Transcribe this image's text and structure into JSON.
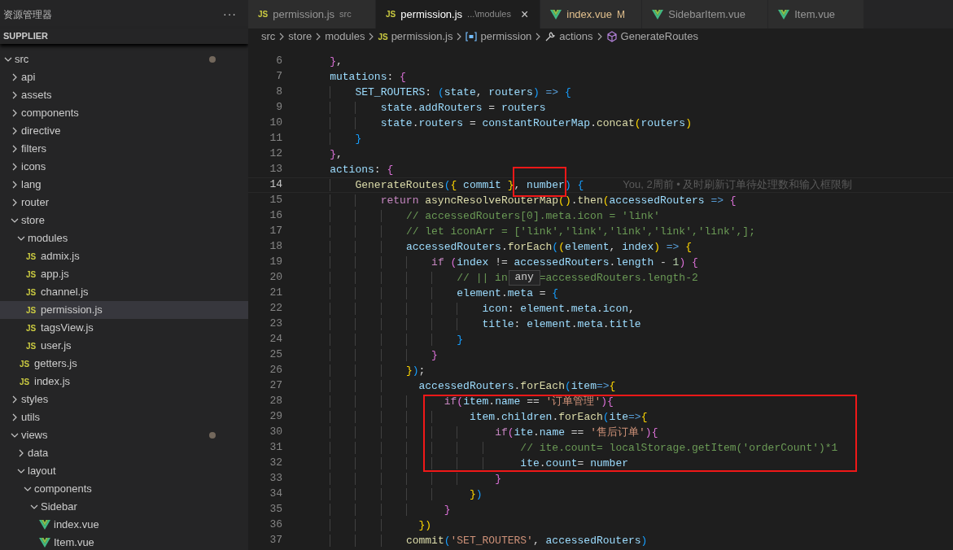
{
  "sidebar": {
    "title": "资源管理器",
    "more": "···",
    "section": "SUPPLIER",
    "tree": [
      {
        "label": "src",
        "kind": "folder",
        "expanded": true,
        "selected": false,
        "modified": true,
        "children": [
          {
            "label": "api",
            "kind": "folder",
            "expanded": false,
            "selected": false,
            "modified": false
          },
          {
            "label": "assets",
            "kind": "folder",
            "expanded": false,
            "selected": false,
            "modified": false
          },
          {
            "label": "components",
            "kind": "folder",
            "expanded": false,
            "selected": false,
            "modified": false
          },
          {
            "label": "directive",
            "kind": "folder",
            "expanded": false,
            "selected": false,
            "modified": false
          },
          {
            "label": "filters",
            "kind": "folder",
            "expanded": false,
            "selected": false,
            "modified": false
          },
          {
            "label": "icons",
            "kind": "folder",
            "expanded": false,
            "selected": false,
            "modified": false
          },
          {
            "label": "lang",
            "kind": "folder",
            "expanded": false,
            "selected": false,
            "modified": false
          },
          {
            "label": "router",
            "kind": "folder",
            "expanded": false,
            "selected": false,
            "modified": false
          },
          {
            "label": "store",
            "kind": "folder",
            "expanded": true,
            "selected": false,
            "modified": false,
            "children": [
              {
                "label": "modules",
                "kind": "folder",
                "expanded": true,
                "selected": false,
                "modified": false,
                "children": [
                  {
                    "label": "admix.js",
                    "kind": "js",
                    "badge": "JS",
                    "selected": false,
                    "modified": false
                  },
                  {
                    "label": "app.js",
                    "kind": "js",
                    "badge": "JS",
                    "selected": false,
                    "modified": false
                  },
                  {
                    "label": "channel.js",
                    "kind": "js",
                    "badge": "JS",
                    "selected": false,
                    "modified": false
                  },
                  {
                    "label": "permission.js",
                    "kind": "js",
                    "badge": "JS",
                    "selected": true,
                    "modified": false
                  },
                  {
                    "label": "tagsView.js",
                    "kind": "js",
                    "badge": "JS",
                    "selected": false,
                    "modified": false
                  },
                  {
                    "label": "user.js",
                    "kind": "js",
                    "badge": "JS",
                    "selected": false,
                    "modified": false
                  }
                ]
              },
              {
                "label": "getters.js",
                "kind": "js",
                "badge": "JS",
                "selected": false,
                "modified": false
              },
              {
                "label": "index.js",
                "kind": "js",
                "badge": "JS",
                "selected": false,
                "modified": false
              }
            ]
          },
          {
            "label": "styles",
            "kind": "folder",
            "expanded": false,
            "selected": false,
            "modified": false
          },
          {
            "label": "utils",
            "kind": "folder",
            "expanded": false,
            "selected": false,
            "modified": false
          },
          {
            "label": "views",
            "kind": "folder",
            "expanded": true,
            "selected": false,
            "modified": true,
            "children": [
              {
                "label": "data",
                "kind": "folder",
                "expanded": false,
                "selected": false,
                "modified": false
              },
              {
                "label": "layout",
                "kind": "folder",
                "expanded": true,
                "selected": false,
                "modified": false,
                "children": [
                  {
                    "label": "components",
                    "kind": "folder",
                    "expanded": true,
                    "selected": false,
                    "modified": false,
                    "children": [
                      {
                        "label": "Sidebar",
                        "kind": "folder",
                        "expanded": true,
                        "selected": false,
                        "modified": false,
                        "children": [
                          {
                            "label": "index.vue",
                            "kind": "vue",
                            "selected": false,
                            "modified": false
                          },
                          {
                            "label": "Item.vue",
                            "kind": "vue",
                            "selected": false,
                            "modified": false
                          }
                        ]
                      }
                    ]
                  }
                ]
              }
            ]
          }
        ]
      }
    ]
  },
  "tabs": [
    {
      "label": "permission.js",
      "kind": "js",
      "badge": "JS",
      "description": "src",
      "modified": false,
      "selected": false
    },
    {
      "label": "permission.js",
      "kind": "js",
      "badge": "JS",
      "description": "...\\modules",
      "close": "×",
      "modified": false,
      "selected": true
    },
    {
      "label": "index.vue",
      "kind": "vue",
      "git_status": "M",
      "modified": true,
      "selected": false
    },
    {
      "label": "SidebarItem.vue",
      "kind": "vue",
      "modified": false,
      "selected": false
    },
    {
      "label": "Item.vue",
      "kind": "vue",
      "modified": false,
      "selected": false
    }
  ],
  "breadcrumb": [
    {
      "kind": "folder",
      "label": "src"
    },
    {
      "kind": "folder",
      "label": "store"
    },
    {
      "kind": "folder",
      "label": "modules"
    },
    {
      "kind": "js",
      "badge": "JS",
      "label": "permission.js"
    },
    {
      "kind": "variable",
      "label": "permission"
    },
    {
      "kind": "property",
      "label": "actions"
    },
    {
      "kind": "method",
      "label": "GenerateRoutes"
    }
  ],
  "editor": {
    "lines": [
      {
        "number": "6",
        "current": false,
        "tokens": [
          {
            "kind": "bracket2",
            "text": "    }"
          },
          {
            "kind": "plain",
            "text": ","
          }
        ]
      },
      {
        "number": "7",
        "current": false,
        "tokens": [
          {
            "kind": "name",
            "text": "    mutations"
          },
          {
            "kind": "plain",
            "text": ": "
          },
          {
            "kind": "bracket2",
            "text": "{"
          }
        ]
      },
      {
        "number": "8",
        "current": false,
        "tokens": [
          {
            "kind": "name",
            "text": "        SET_ROUTERS"
          },
          {
            "kind": "plain",
            "text": ": "
          },
          {
            "kind": "bracket3",
            "text": "("
          },
          {
            "kind": "name",
            "text": "state"
          },
          {
            "kind": "plain",
            "text": ", "
          },
          {
            "kind": "name",
            "text": "routers"
          },
          {
            "kind": "bracket3",
            "text": ") "
          },
          {
            "kind": "arrow",
            "text": "=> "
          },
          {
            "kind": "bracket3",
            "text": "{"
          }
        ]
      },
      {
        "number": "9",
        "current": false,
        "tokens": [
          {
            "kind": "name",
            "text": "            state"
          },
          {
            "kind": "plain",
            "text": "."
          },
          {
            "kind": "name",
            "text": "addRouters"
          },
          {
            "kind": "plain",
            "text": " = "
          },
          {
            "kind": "name",
            "text": "routers"
          }
        ]
      },
      {
        "number": "10",
        "current": false,
        "tokens": [
          {
            "kind": "name",
            "text": "            state"
          },
          {
            "kind": "plain",
            "text": "."
          },
          {
            "kind": "name",
            "text": "routers"
          },
          {
            "kind": "plain",
            "text": " = "
          },
          {
            "kind": "name",
            "text": "constantRouterMap"
          },
          {
            "kind": "plain",
            "text": "."
          },
          {
            "kind": "func",
            "text": "concat"
          },
          {
            "kind": "bracket1",
            "text": "("
          },
          {
            "kind": "name",
            "text": "routers"
          },
          {
            "kind": "bracket1",
            "text": ")"
          }
        ]
      },
      {
        "number": "11",
        "current": false,
        "tokens": [
          {
            "kind": "bracket3",
            "text": "        }"
          }
        ]
      },
      {
        "number": "12",
        "current": false,
        "tokens": [
          {
            "kind": "bracket2",
            "text": "    }"
          },
          {
            "kind": "plain",
            "text": ","
          }
        ]
      },
      {
        "number": "13",
        "current": false,
        "tokens": [
          {
            "kind": "name",
            "text": "    actions"
          },
          {
            "kind": "plain",
            "text": ": "
          },
          {
            "kind": "bracket2",
            "text": "{"
          }
        ]
      },
      {
        "number": "14",
        "current": true,
        "blame": "You, 2周前 • 及时刷新订单待处理数和输入框限制",
        "tokens": [
          {
            "kind": "func",
            "text": "        GenerateRoutes"
          },
          {
            "kind": "bracket3",
            "text": "("
          },
          {
            "kind": "bracket1",
            "text": "{ "
          },
          {
            "kind": "name",
            "text": "commit "
          },
          {
            "kind": "bracket1",
            "text": "}"
          },
          {
            "kind": "plain",
            "text": ", "
          },
          {
            "kind": "name",
            "text": "number"
          },
          {
            "kind": "bracket3",
            "text": ") {"
          }
        ]
      },
      {
        "number": "15",
        "current": false,
        "tokens": [
          {
            "kind": "keyword",
            "text": "            return "
          },
          {
            "kind": "func",
            "text": "asyncResolveRouterMap"
          },
          {
            "kind": "bracket1",
            "text": "()"
          },
          {
            "kind": "plain",
            "text": "."
          },
          {
            "kind": "func",
            "text": "then"
          },
          {
            "kind": "bracket1",
            "text": "("
          },
          {
            "kind": "name",
            "text": "accessedRouters "
          },
          {
            "kind": "arrow",
            "text": "=> "
          },
          {
            "kind": "bracket2",
            "text": "{"
          }
        ]
      },
      {
        "number": "16",
        "current": false,
        "tokens": [
          {
            "kind": "comment",
            "text": "                // accessedRouters[0].meta.icon = 'link'"
          }
        ]
      },
      {
        "number": "17",
        "current": false,
        "tokens": [
          {
            "kind": "comment",
            "text": "                // let iconArr = ['link','link','link','link','link',];"
          }
        ]
      },
      {
        "number": "18",
        "current": false,
        "tokens": [
          {
            "kind": "name",
            "text": "                accessedRouters"
          },
          {
            "kind": "plain",
            "text": "."
          },
          {
            "kind": "func",
            "text": "forEach"
          },
          {
            "kind": "bracket3",
            "text": "("
          },
          {
            "kind": "bracket1",
            "text": "("
          },
          {
            "kind": "name",
            "text": "element"
          },
          {
            "kind": "plain",
            "text": ", "
          },
          {
            "kind": "name",
            "text": "index"
          },
          {
            "kind": "bracket1",
            "text": ") "
          },
          {
            "kind": "arrow",
            "text": "=> "
          },
          {
            "kind": "bracket1",
            "text": "{"
          }
        ]
      },
      {
        "number": "19",
        "current": false,
        "tokens": [
          {
            "kind": "keyword",
            "text": "                    if "
          },
          {
            "kind": "bracket2",
            "text": "("
          },
          {
            "kind": "name",
            "text": "index"
          },
          {
            "kind": "plain",
            "text": " != "
          },
          {
            "kind": "name",
            "text": "accessedRouters"
          },
          {
            "kind": "plain",
            "text": "."
          },
          {
            "kind": "name",
            "text": "length"
          },
          {
            "kind": "plain",
            "text": " - "
          },
          {
            "kind": "number",
            "text": "1"
          },
          {
            "kind": "bracket2",
            "text": ") {"
          }
        ]
      },
      {
        "number": "20",
        "current": false,
        "hover_tip": "any",
        "tokens": [
          {
            "kind": "comment",
            "text": "                        // || in     =accessedRouters.length-2"
          }
        ]
      },
      {
        "number": "21",
        "current": false,
        "tokens": [
          {
            "kind": "name",
            "text": "                        element"
          },
          {
            "kind": "plain",
            "text": "."
          },
          {
            "kind": "name",
            "text": "meta"
          },
          {
            "kind": "plain",
            "text": " = "
          },
          {
            "kind": "bracket3",
            "text": "{"
          }
        ]
      },
      {
        "number": "22",
        "current": false,
        "tokens": [
          {
            "kind": "name",
            "text": "                            icon"
          },
          {
            "kind": "plain",
            "text": ": "
          },
          {
            "kind": "name",
            "text": "element"
          },
          {
            "kind": "plain",
            "text": "."
          },
          {
            "kind": "name",
            "text": "meta"
          },
          {
            "kind": "plain",
            "text": "."
          },
          {
            "kind": "name",
            "text": "icon"
          },
          {
            "kind": "plain",
            "text": ","
          }
        ]
      },
      {
        "number": "23",
        "current": false,
        "tokens": [
          {
            "kind": "name",
            "text": "                            title"
          },
          {
            "kind": "plain",
            "text": ": "
          },
          {
            "kind": "name",
            "text": "element"
          },
          {
            "kind": "plain",
            "text": "."
          },
          {
            "kind": "name",
            "text": "meta"
          },
          {
            "kind": "plain",
            "text": "."
          },
          {
            "kind": "name",
            "text": "title"
          }
        ]
      },
      {
        "number": "24",
        "current": false,
        "tokens": [
          {
            "kind": "bracket3",
            "text": "                        }"
          }
        ]
      },
      {
        "number": "25",
        "current": false,
        "tokens": [
          {
            "kind": "bracket2",
            "text": "                    }"
          }
        ]
      },
      {
        "number": "26",
        "current": false,
        "tokens": [
          {
            "kind": "bracket1",
            "text": "                }"
          },
          {
            "kind": "bracket3",
            "text": ")"
          },
          {
            "kind": "plain",
            "text": ";"
          }
        ]
      },
      {
        "number": "27",
        "current": false,
        "tokens": [
          {
            "kind": "name",
            "text": "                  accessedRouters"
          },
          {
            "kind": "plain",
            "text": "."
          },
          {
            "kind": "func",
            "text": "forEach"
          },
          {
            "kind": "bracket3",
            "text": "("
          },
          {
            "kind": "name",
            "text": "item"
          },
          {
            "kind": "arrow",
            "text": "=>"
          },
          {
            "kind": "bracket1",
            "text": "{"
          }
        ]
      },
      {
        "number": "28",
        "current": false,
        "tokens": [
          {
            "kind": "keyword",
            "text": "                      if"
          },
          {
            "kind": "bracket2",
            "text": "("
          },
          {
            "kind": "name",
            "text": "item"
          },
          {
            "kind": "plain",
            "text": "."
          },
          {
            "kind": "name",
            "text": "name"
          },
          {
            "kind": "plain",
            "text": " == "
          },
          {
            "kind": "string",
            "text": "'订单管理'"
          },
          {
            "kind": "bracket2",
            "text": "){"
          }
        ]
      },
      {
        "number": "29",
        "current": false,
        "tokens": [
          {
            "kind": "name",
            "text": "                          item"
          },
          {
            "kind": "plain",
            "text": "."
          },
          {
            "kind": "name",
            "text": "children"
          },
          {
            "kind": "plain",
            "text": "."
          },
          {
            "kind": "func",
            "text": "forEach"
          },
          {
            "kind": "bracket3",
            "text": "("
          },
          {
            "kind": "name",
            "text": "ite"
          },
          {
            "kind": "arrow",
            "text": "=>"
          },
          {
            "kind": "bracket1",
            "text": "{"
          }
        ]
      },
      {
        "number": "30",
        "current": false,
        "tokens": [
          {
            "kind": "keyword",
            "text": "                              if"
          },
          {
            "kind": "bracket2",
            "text": "("
          },
          {
            "kind": "name",
            "text": "ite"
          },
          {
            "kind": "plain",
            "text": "."
          },
          {
            "kind": "name",
            "text": "name"
          },
          {
            "kind": "plain",
            "text": " == "
          },
          {
            "kind": "string",
            "text": "'售后订单'"
          },
          {
            "kind": "bracket2",
            "text": "){"
          }
        ]
      },
      {
        "number": "31",
        "current": false,
        "tokens": [
          {
            "kind": "comment",
            "text": "                                  // ite.count= localStorage.getItem('orderCount')*1"
          }
        ]
      },
      {
        "number": "32",
        "current": false,
        "tokens": [
          {
            "kind": "name",
            "text": "                                  ite"
          },
          {
            "kind": "plain",
            "text": "."
          },
          {
            "kind": "name",
            "text": "count"
          },
          {
            "kind": "plain",
            "text": "= "
          },
          {
            "kind": "name",
            "text": "number"
          }
        ]
      },
      {
        "number": "33",
        "current": false,
        "tokens": [
          {
            "kind": "bracket2",
            "text": "                              }"
          }
        ]
      },
      {
        "number": "34",
        "current": false,
        "tokens": [
          {
            "kind": "bracket1",
            "text": "                          }"
          },
          {
            "kind": "bracket3",
            "text": ")"
          }
        ]
      },
      {
        "number": "35",
        "current": false,
        "tokens": [
          {
            "kind": "bracket2",
            "text": "                      }"
          }
        ]
      },
      {
        "number": "36",
        "current": false,
        "tokens": [
          {
            "kind": "bracket1",
            "text": "                  })"
          }
        ]
      },
      {
        "number": "37",
        "current": false,
        "tokens": [
          {
            "kind": "func",
            "text": "                commit"
          },
          {
            "kind": "bracket3",
            "text": "("
          },
          {
            "kind": "string",
            "text": "'SET_ROUTERS'"
          },
          {
            "kind": "plain",
            "text": ", "
          },
          {
            "kind": "name",
            "text": "accessedRouters"
          },
          {
            "kind": "bracket3",
            "text": ")"
          }
        ]
      }
    ]
  }
}
